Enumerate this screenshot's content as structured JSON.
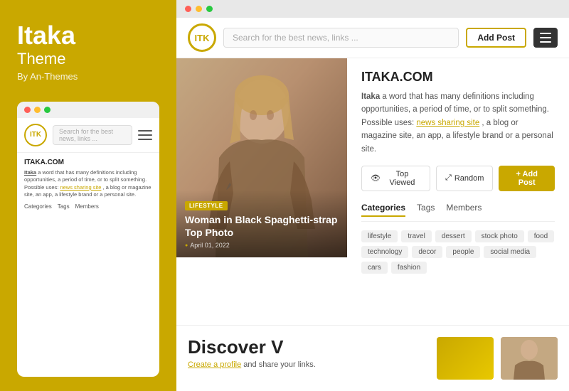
{
  "left": {
    "title": "Itaka",
    "subtitle": "Theme",
    "byline": "By An-Themes",
    "mini": {
      "logo": "ITK",
      "search_placeholder": "Search for the best news, links ...",
      "site_title": "ITAKA.COM",
      "description": "Itaka a word that has many definitions including opportunities, a period of time, or to split something. Possible uses:",
      "link1": "news sharing site",
      "description2": ", a blog or magazine site, an app, a lifestyle brand or a personal site.",
      "nav": [
        "Categories",
        "Tags",
        "Members"
      ]
    }
  },
  "browser": {
    "dots": [
      "red",
      "yellow",
      "green"
    ]
  },
  "nav": {
    "logo": "ITK",
    "search_placeholder": "Search for the best news, links ...",
    "add_post_label": "Add Post",
    "hamburger_label": "menu"
  },
  "hero": {
    "badge": "LIFESTYLE",
    "title": "Woman in Black Spaghetti-strap Top Photo",
    "date": "April 01, 2022"
  },
  "sidebar": {
    "site_title": "ITAKA.COM",
    "description_pre": "a word that has many definitions including opportunities, a period of time, or to split something. Possible uses: ",
    "link_text": "news sharing site",
    "description_post": ", a blog or magazine site, an app, a lifestyle brand or a personal site.",
    "strong_text": "Itaka",
    "buttons": {
      "top_viewed": "Top Viewed",
      "random": "Random",
      "add_post": "+ Add Post"
    },
    "tabs": [
      "Categories",
      "Tags",
      "Members"
    ],
    "active_tab": "Categories",
    "tags": [
      "lifestyle",
      "travel",
      "dessert",
      "stock photo",
      "food",
      "technology",
      "decor",
      "people",
      "social media",
      "cars",
      "fashion"
    ]
  },
  "bottom": {
    "heading": "Discover V",
    "sub_link": "Create a profile",
    "sub_text": " and share your links."
  },
  "icons": {
    "eye": "👁",
    "shuffle": "⤢",
    "plus": "+",
    "calendar": "📅"
  }
}
